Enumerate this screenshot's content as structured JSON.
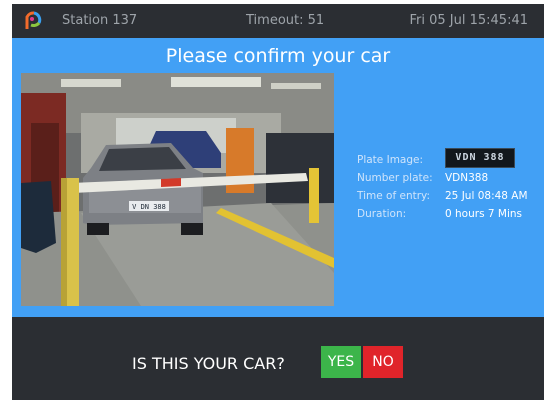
{
  "topbar": {
    "station": "Station 137",
    "timeout": "Timeout: 51",
    "datetime": "Fri 05 Jul 15:45:41",
    "logo_icon": "app-logo-icon"
  },
  "main": {
    "title": "Please confirm your car",
    "background_color": "#42a0f5"
  },
  "photo": {
    "plate_text": "V DN 388"
  },
  "details": {
    "plate_image_label": "Plate Image:",
    "plate_image_text": "VDN 388",
    "number_plate_label": "Number plate:",
    "number_plate_value": "VDN388",
    "time_of_entry_label": "Time of entry:",
    "time_of_entry_value": "25 Jul 08:48 AM",
    "duration_label": "Duration:",
    "duration_value": "0 hours 7 Mins"
  },
  "footer": {
    "question": "IS THIS YOUR CAR?",
    "yes_label": "YES",
    "no_label": "NO",
    "yes_color": "#3cb54a",
    "no_color": "#e0242a"
  }
}
